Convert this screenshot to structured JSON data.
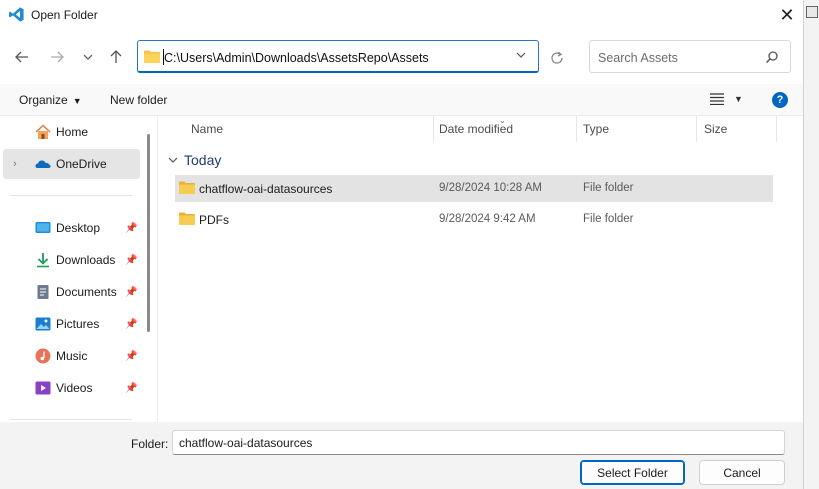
{
  "window": {
    "title": "Open Folder",
    "icon": "vscode-icon",
    "close_icon": "close-icon"
  },
  "nav": {
    "back_icon": "arrow-left-icon",
    "forward_icon": "arrow-right-icon",
    "recent_icon": "chevron-down-icon",
    "up_icon": "arrow-up-icon",
    "address_path": "C:\\Users\\Admin\\Downloads\\AssetsRepo\\Assets",
    "refresh_icon": "refresh-icon",
    "search_placeholder": "Search Assets"
  },
  "commands": {
    "organize": "Organize",
    "new_folder": "New folder",
    "view_icon": "view-list-icon",
    "help_icon": "help-icon",
    "help_glyph": "?"
  },
  "sidebar": {
    "items": [
      {
        "label": "Home",
        "icon": "home-icon"
      },
      {
        "label": "OneDrive",
        "icon": "onedrive-icon"
      },
      {
        "label": "Desktop",
        "icon": "desktop-icon"
      },
      {
        "label": "Downloads",
        "icon": "downloads-icon"
      },
      {
        "label": "Documents",
        "icon": "documents-icon"
      },
      {
        "label": "Pictures",
        "icon": "pictures-icon"
      },
      {
        "label": "Music",
        "icon": "music-icon"
      },
      {
        "label": "Videos",
        "icon": "videos-icon"
      }
    ]
  },
  "columns": {
    "name": "Name",
    "date": "Date modified",
    "type": "Type",
    "size": "Size"
  },
  "group": {
    "label": "Today"
  },
  "files": [
    {
      "name": "chatflow-oai-datasources",
      "date": "9/28/2024 10:28 AM",
      "type": "File folder",
      "selected": true
    },
    {
      "name": "PDFs",
      "date": "9/28/2024 9:42 AM",
      "type": "File folder",
      "selected": false
    }
  ],
  "footer": {
    "folder_label": "Folder:",
    "folder_value": "chatflow-oai-datasources",
    "select_button": "Select Folder",
    "cancel_button": "Cancel"
  },
  "colors": {
    "accent": "#0067c0",
    "folder": "#f6c444",
    "selection": "#e3e3e3"
  }
}
